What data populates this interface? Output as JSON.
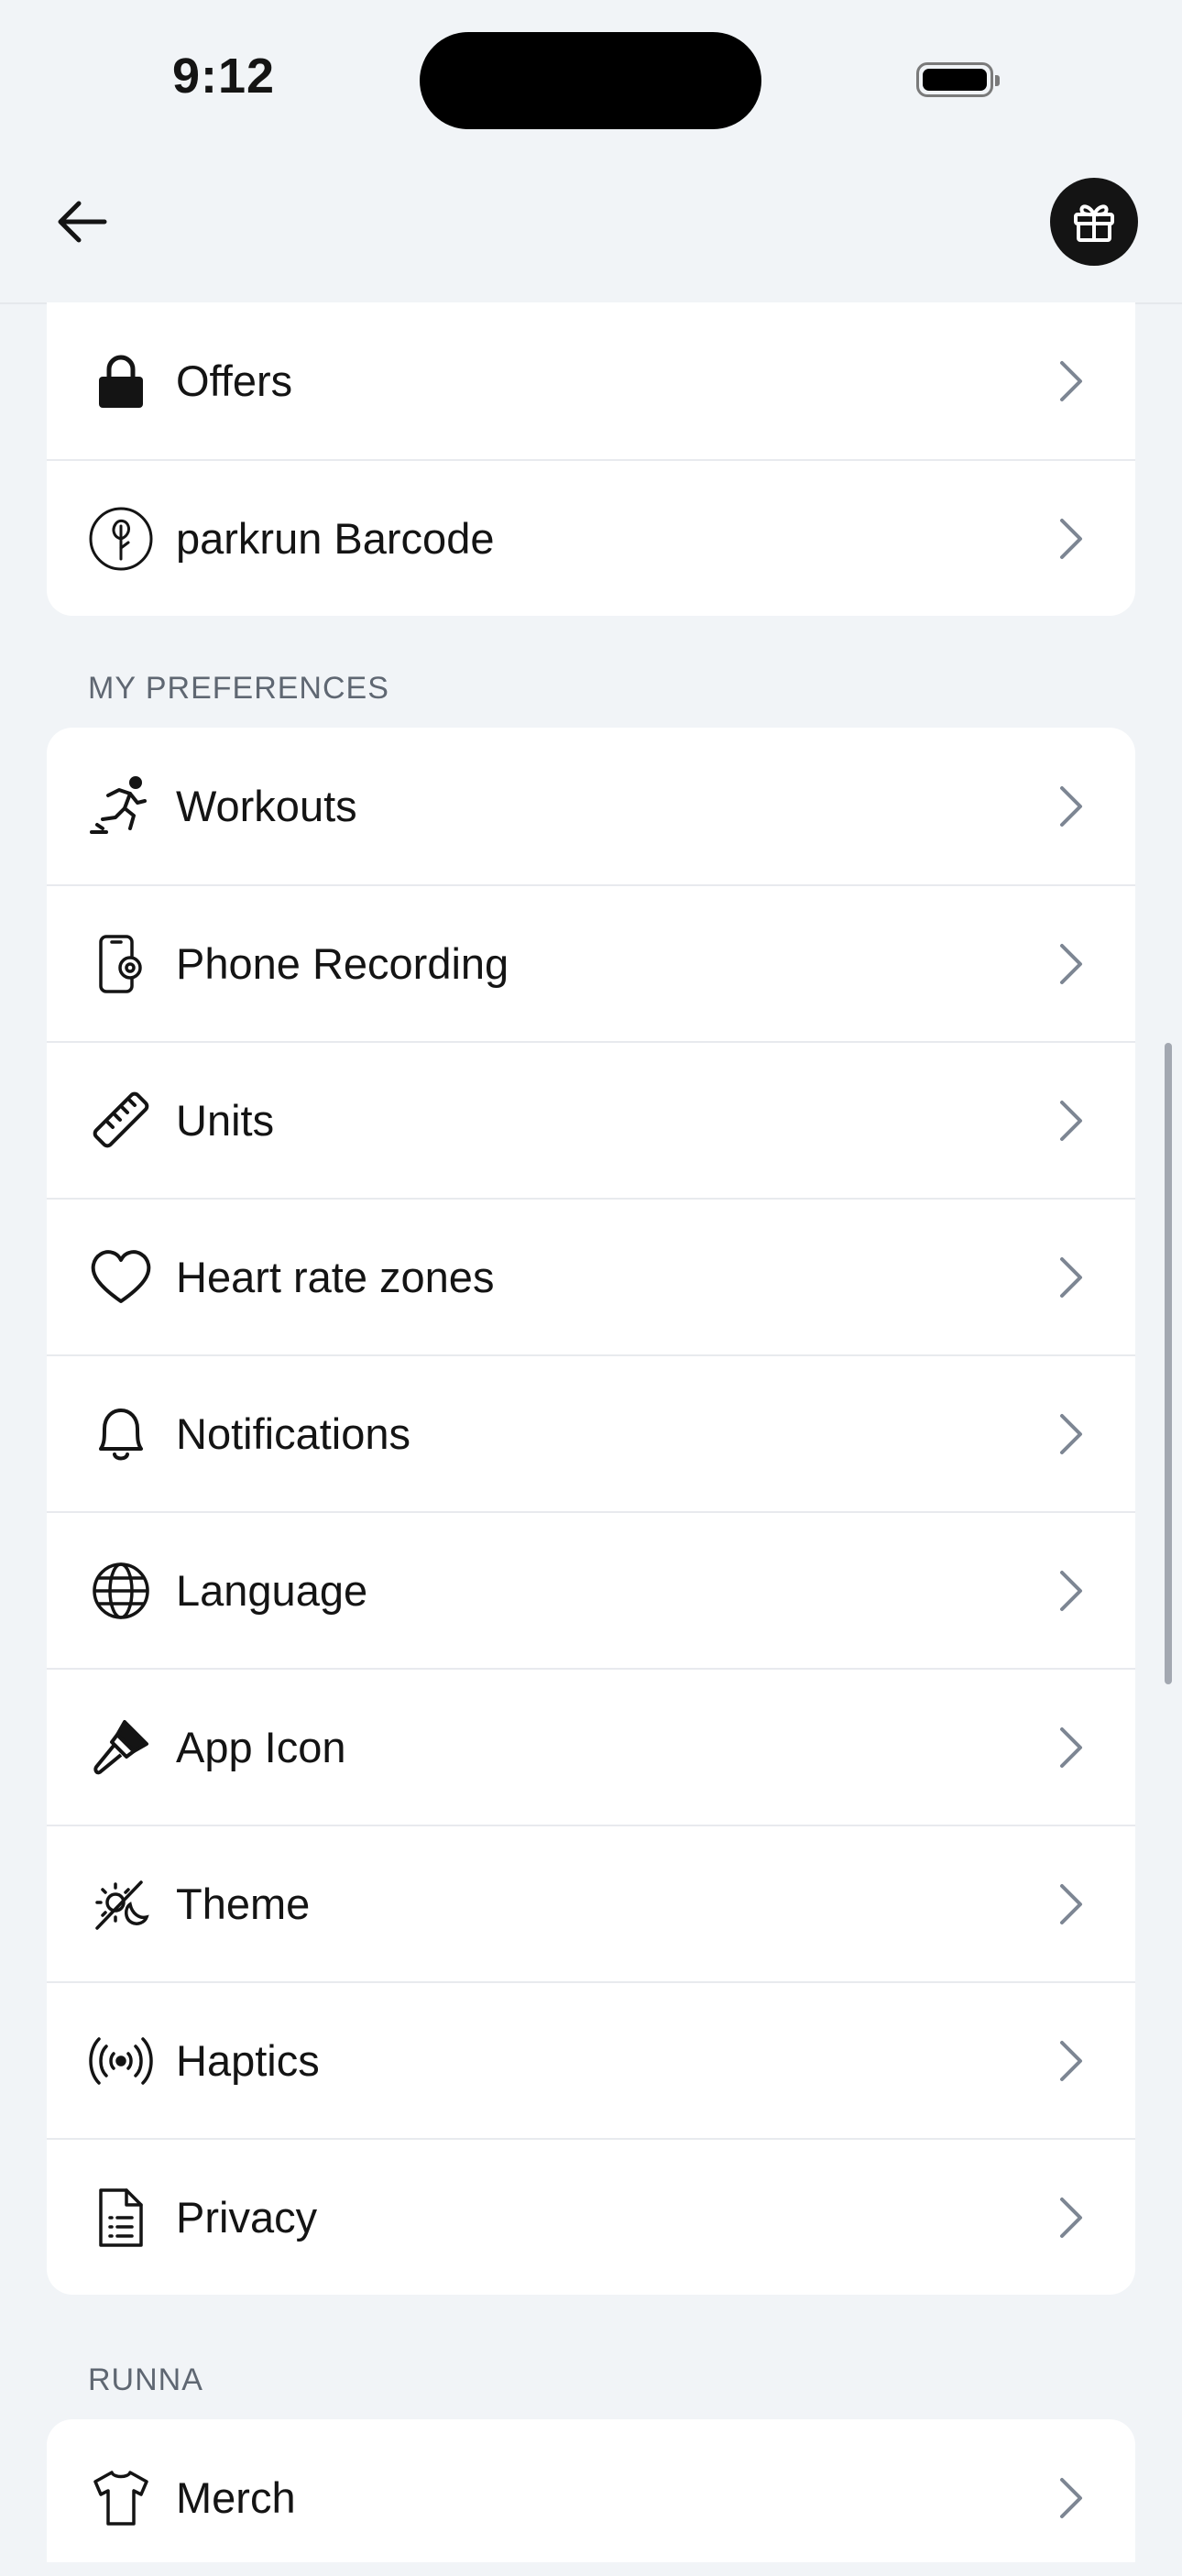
{
  "status_bar": {
    "time": "9:12"
  },
  "top_card": {
    "items": [
      {
        "label": "Offers",
        "icon": "lock-icon"
      },
      {
        "label": "parkrun Barcode",
        "icon": "parkrun-icon"
      }
    ]
  },
  "preferences": {
    "title": "MY PREFERENCES",
    "items": [
      {
        "label": "Workouts",
        "icon": "runner-icon"
      },
      {
        "label": "Phone Recording",
        "icon": "phone-recording-icon"
      },
      {
        "label": "Units",
        "icon": "ruler-icon"
      },
      {
        "label": "Heart rate zones",
        "icon": "heart-icon"
      },
      {
        "label": "Notifications",
        "icon": "bell-icon"
      },
      {
        "label": "Language",
        "icon": "globe-icon"
      },
      {
        "label": "App Icon",
        "icon": "paintbrush-icon"
      },
      {
        "label": "Theme",
        "icon": "theme-icon"
      },
      {
        "label": "Haptics",
        "icon": "haptics-icon"
      },
      {
        "label": "Privacy",
        "icon": "document-icon"
      }
    ]
  },
  "runna": {
    "title": "RUNNA",
    "items": [
      {
        "label": "Merch",
        "icon": "tshirt-icon"
      }
    ]
  }
}
